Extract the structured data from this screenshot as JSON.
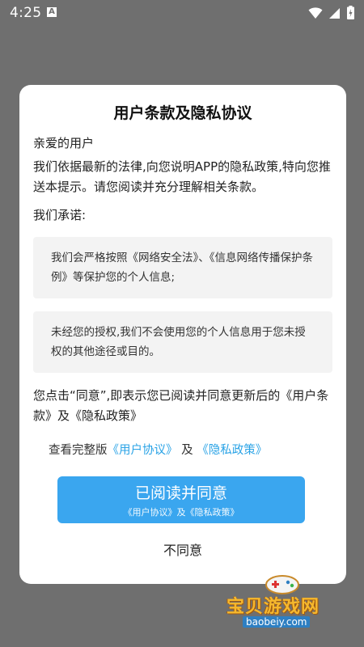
{
  "status_bar": {
    "time": "4:25",
    "notification_icon": "A"
  },
  "dialog": {
    "title": "用户条款及隐私协议",
    "greeting": "亲爱的用户",
    "intro": "我们依据最新的法律,向您说明APP的隐私政策,特向您推送本提示。请您阅读并充分理解相关条款。",
    "promise_heading": "我们承诺:",
    "cards": [
      "我们会严格按照《网络安全法》、《信息网络传播保护条例》等保护您的个人信息;",
      "未经您的授权,我们不会使用您的个人信息用于您未授权的其他途径或目的。"
    ],
    "notice": "您点击“同意”,即表示您已阅读并同意更新后的《用户条款》及《隐私政策》",
    "view_prefix": "查看完整版",
    "user_agreement_link": "《用户协议》",
    "and": "及",
    "privacy_policy_link": "《隐私政策》",
    "agree_button": "已阅读并同意",
    "agree_button_sub": "《用户协议》及《隐私政策》",
    "disagree_button": "不同意"
  },
  "watermark": {
    "title": "宝贝游戏网",
    "url": "baobeiy.com"
  },
  "colors": {
    "accent": "#3aa6ef",
    "link": "#2aa3e6",
    "overlay": "#6f6f6f"
  }
}
